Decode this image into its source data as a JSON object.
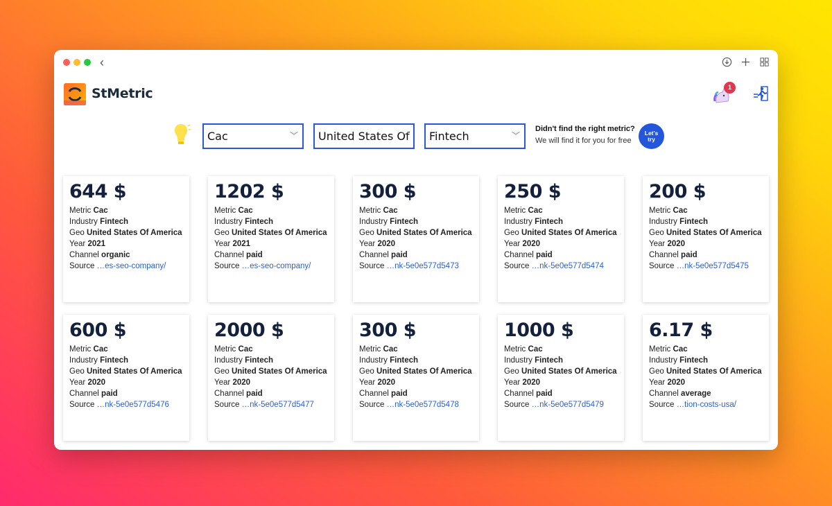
{
  "app": {
    "brand": "StMetric",
    "notification_count": "1"
  },
  "filters": {
    "metric": "Cac",
    "geo": "United States Of",
    "industry": "Fintech",
    "cta_title": "Didn't find the right metric?",
    "cta_subtitle": "We will find it for you for free",
    "cta_button_line1": "Let's",
    "cta_button_line2": "try"
  },
  "labels": {
    "metric": "Metric",
    "industry": "Industry",
    "geo": "Geo",
    "year": "Year",
    "channel": "Channel",
    "source": "Source"
  },
  "cards": [
    {
      "amount": "644 $",
      "metric": "Cac",
      "industry": "Fintech",
      "geo": "United States Of America",
      "year": "2021",
      "channel": "organic",
      "source": "…es-seo-company/"
    },
    {
      "amount": "1202 $",
      "metric": "Cac",
      "industry": "Fintech",
      "geo": "United States Of America",
      "year": "2021",
      "channel": "paid",
      "source": "…es-seo-company/"
    },
    {
      "amount": "300 $",
      "metric": "Cac",
      "industry": "Fintech",
      "geo": "United States Of America",
      "year": "2020",
      "channel": "paid",
      "source": "…nk-5e0e577d5473"
    },
    {
      "amount": "250 $",
      "metric": "Cac",
      "industry": "Fintech",
      "geo": "United States Of America",
      "year": "2020",
      "channel": "paid",
      "source": "…nk-5e0e577d5474"
    },
    {
      "amount": "200 $",
      "metric": "Cac",
      "industry": "Fintech",
      "geo": "United States Of America",
      "year": "2020",
      "channel": "paid",
      "source": "…nk-5e0e577d5475"
    },
    {
      "amount": "600 $",
      "metric": "Cac",
      "industry": "Fintech",
      "geo": "United States Of America",
      "year": "2020",
      "channel": "paid",
      "source": "…nk-5e0e577d5476"
    },
    {
      "amount": "2000 $",
      "metric": "Cac",
      "industry": "Fintech",
      "geo": "United States Of America",
      "year": "2020",
      "channel": "paid",
      "source": "…nk-5e0e577d5477"
    },
    {
      "amount": "300 $",
      "metric": "Cac",
      "industry": "Fintech",
      "geo": "United States Of America",
      "year": "2020",
      "channel": "paid",
      "source": "…nk-5e0e577d5478"
    },
    {
      "amount": "1000 $",
      "metric": "Cac",
      "industry": "Fintech",
      "geo": "United States Of America",
      "year": "2020",
      "channel": "paid",
      "source": "…nk-5e0e577d5479"
    },
    {
      "amount": "6.17 $",
      "metric": "Cac",
      "industry": "Fintech",
      "geo": "United States Of America",
      "year": "2020",
      "channel": "average",
      "source": "…tion-costs-usa/"
    }
  ],
  "colors": {
    "accent": "#2356db",
    "select_border": "#2a57d6",
    "amount": "#14213d",
    "link": "#2a5fd0",
    "badge": "#e0364e"
  },
  "icons": [
    "back-arrow-icon",
    "download-icon",
    "plus-icon",
    "grid-icon",
    "logo-icon",
    "unicorn-icon",
    "runner-icon",
    "lightbulb-icon",
    "chevron-down-icon"
  ]
}
